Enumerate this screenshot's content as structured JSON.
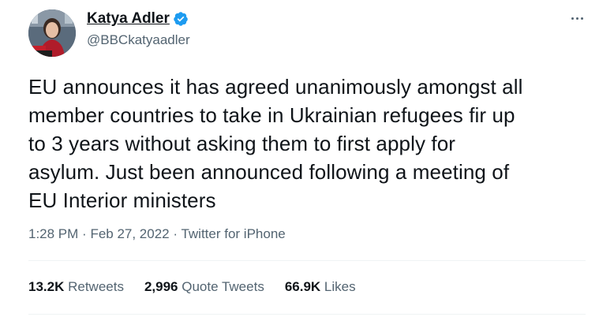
{
  "author": {
    "display_name": "Katya Adler",
    "handle": "@BBCkatyaadler",
    "verified": true
  },
  "icons": {
    "avatar": "profile-photo",
    "verified": "verified-badge-icon",
    "more": "more-options-icon"
  },
  "colors": {
    "verified_blue": "#1d9bf0",
    "text_primary": "#0f1419",
    "text_secondary": "#536471",
    "divider": "#eff3f4"
  },
  "tweet": {
    "text": "EU announces it has agreed unanimously amongst all\nmember countries to take in Ukrainian refugees fir up\nto 3 years without asking them to first apply for\nasylum. Just been announced following a meeting of\nEU Interior ministers",
    "time": "1:28 PM",
    "date": "Feb 27, 2022",
    "source": "Twitter for iPhone",
    "separator": "·"
  },
  "stats": {
    "retweets_count": "13.2K",
    "retweets_label": "Retweets",
    "quote_count": "2,996",
    "quote_label": "Quote Tweets",
    "likes_count": "66.9K",
    "likes_label": "Likes"
  }
}
